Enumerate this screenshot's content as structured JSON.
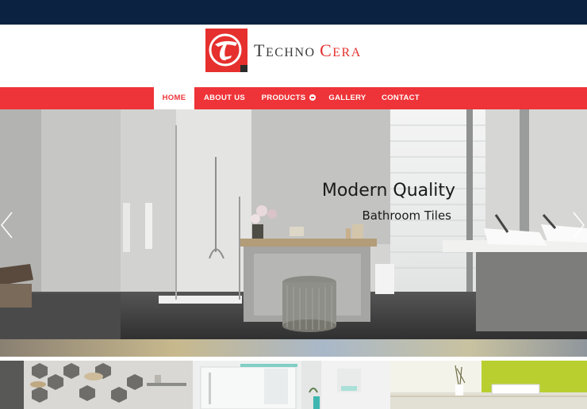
{
  "brand": {
    "name_part1": "Techno",
    "name_part2": "Cera"
  },
  "nav": {
    "items": [
      {
        "label": "HOME",
        "active": true
      },
      {
        "label": "ABOUT US",
        "active": false
      },
      {
        "label": "PRODUCTS",
        "active": false,
        "has_dropdown": true
      },
      {
        "label": "GALLERY",
        "active": false
      },
      {
        "label": "CONTACT",
        "active": false
      }
    ]
  },
  "slider": {
    "title": "Modern Quality",
    "subtitle": "Bathroom Tiles",
    "prev_icon": "chevron-left-icon",
    "next_icon": "chevron-right-icon"
  },
  "colors": {
    "topbar": "#0b2340",
    "brand_red": "#ee3438",
    "text_dark": "#1a1a1a"
  }
}
